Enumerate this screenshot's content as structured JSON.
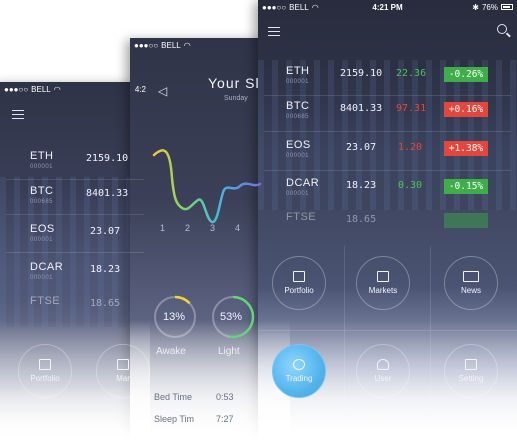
{
  "status": {
    "carrier": "BELL",
    "time_left": "4:2",
    "time_middle": "",
    "time_right": "4:21 PM",
    "battery": "76%"
  },
  "left_phone": {
    "rows": [
      {
        "symbol": "ETH",
        "code": "000001",
        "price": "2159.10"
      },
      {
        "symbol": "BTC",
        "code": "000685",
        "price": "8401.33"
      },
      {
        "symbol": "EOS",
        "code": "000001",
        "price": "23.07"
      },
      {
        "symbol": "DCAR",
        "code": "000001",
        "price": "18.23"
      },
      {
        "symbol": "FTSE",
        "code": "",
        "price": "18.65"
      }
    ],
    "buttons": [
      {
        "label": "Portfolio"
      },
      {
        "label": "Mar"
      }
    ]
  },
  "middle_phone": {
    "title": "Your Sl",
    "subtitle": "Sunday",
    "chart_data": {
      "type": "line",
      "x": [
        1,
        2,
        3,
        4
      ],
      "x_tick_labels": [
        "1",
        "2",
        "3",
        "4"
      ],
      "colors": [
        "#f3c73e",
        "#7cd46d",
        "#46b9d9",
        "#7a6fe0"
      ]
    },
    "rings": [
      {
        "value": "13%",
        "caption": "Awake",
        "percent": 13,
        "color": "#f5d23c"
      },
      {
        "value": "53%",
        "caption": "Light",
        "percent": 53,
        "color": "#64d47a"
      }
    ],
    "stats": [
      {
        "label": "Bed Time",
        "value": "0:53"
      },
      {
        "label": "Sleep Tim",
        "value": "7:27"
      }
    ]
  },
  "right_phone": {
    "rows": [
      {
        "symbol": "ETH",
        "code": "000001",
        "price": "2159.10",
        "change": "22.36",
        "change_color": "#4fc05a",
        "badge": "-0.26%",
        "badge_color": "#3fae4a"
      },
      {
        "symbol": "BTC",
        "code": "000685",
        "price": "8401.33",
        "change": "97.31",
        "change_color": "#e8443a",
        "badge": "+0.16%",
        "badge_color": "#e2463c"
      },
      {
        "symbol": "EOS",
        "code": "000001",
        "price": "23.07",
        "change": "1.20",
        "change_color": "#e8443a",
        "badge": "+1.38%",
        "badge_color": "#e2463c"
      },
      {
        "symbol": "DCAR",
        "code": "000001",
        "price": "18.23",
        "change": "0.30",
        "change_color": "#4fc05a",
        "badge": "-0.15%",
        "badge_color": "#3fae4a"
      },
      {
        "symbol": "FTSE",
        "code": "",
        "price": "18.65",
        "change": "",
        "change_color": "#4fc05a",
        "badge": "",
        "badge_color": "#3fae4a"
      }
    ],
    "buttons": [
      {
        "label": "Portfolio",
        "icon": "chart-icon",
        "active": false
      },
      {
        "label": "Markets",
        "icon": "image-icon",
        "active": false
      },
      {
        "label": "News",
        "icon": "news-icon",
        "active": false
      },
      {
        "label": "Trading",
        "icon": "coins-icon",
        "active": true
      },
      {
        "label": "User",
        "icon": "user-icon",
        "active": false
      },
      {
        "label": "Setting",
        "icon": "settings-icon",
        "active": false
      }
    ]
  }
}
